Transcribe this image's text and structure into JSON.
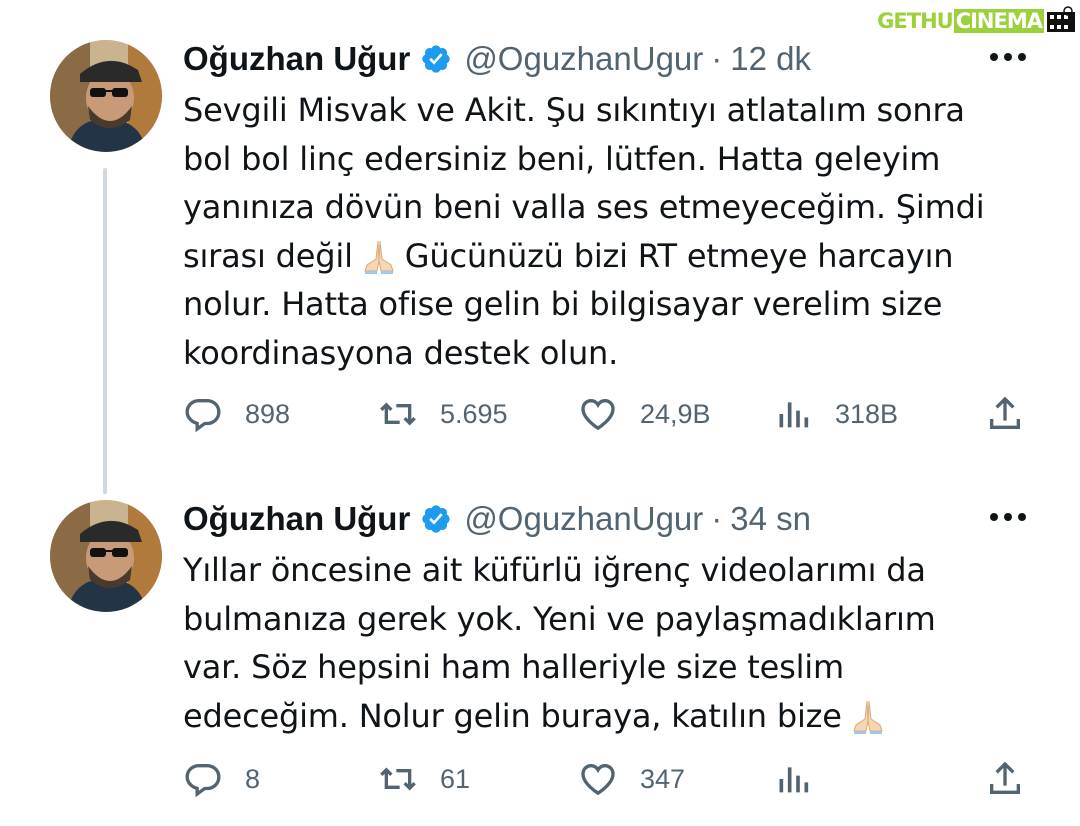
{
  "watermark": {
    "part1": "GETHU",
    "part2": "CINEMA"
  },
  "tweets": [
    {
      "author": "Oğuzhan Uğur",
      "handle": "@OguzhanUgur",
      "separator": "·",
      "time": "12 dk",
      "text_before": "Sevgili Misvak ve Akit. Şu sıkıntıyı atlatalım sonra\nbol bol linç edersiniz beni, lütfen. Hatta geleyim\nyanınıza dövün beni valla ses etmeyeceğim. Şimdi\nsırası değil",
      "text_after": "Gücünüzü bizi RT etmeye harcayın\nnolur. Hatta ofise gelin bi bilgisayar verelim size\nkoordinasyona destek olun.",
      "emoji_icon": "folded-hands-icon",
      "replies": "898",
      "retweets": "5.695",
      "likes": "24,9B",
      "views": "318B"
    },
    {
      "author": "Oğuzhan Uğur",
      "handle": "@OguzhanUgur",
      "separator": "·",
      "time": "34 sn",
      "text_before": "Yıllar öncesine ait küfürlü iğrenç videolarımı da\nbulmanıza gerek yok. Yeni ve paylaşmadıklarım\nvar. Söz hepsini ham halleriyle size teslim\nedeceğim. Nolur gelin buraya, katılın bize",
      "text_after": "",
      "emoji_icon": "folded-hands-icon",
      "replies": "8",
      "retweets": "61",
      "likes": "347",
      "views": ""
    }
  ],
  "colors": {
    "verified": "#1d9bf0",
    "secondary": "#536471",
    "thread_line": "#cfd9de",
    "watermark": "#9bd13a"
  }
}
